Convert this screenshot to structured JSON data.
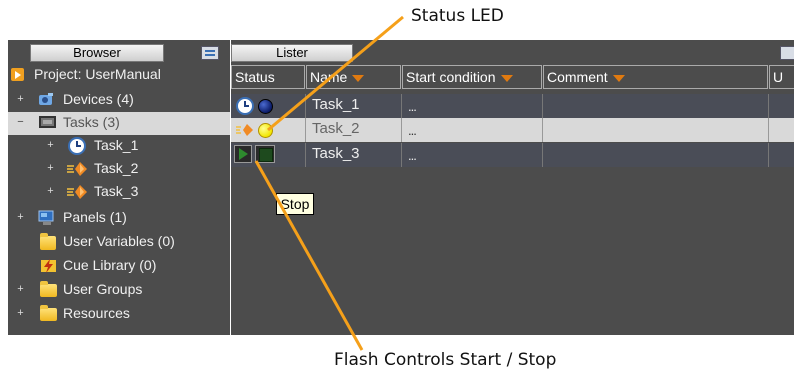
{
  "annotations": {
    "status_led": "Status LED",
    "flash_controls": "Flash Controls Start / Stop"
  },
  "browser": {
    "tab_label": "Browser",
    "items": [
      {
        "label": "Project: UserManual",
        "expander": "",
        "icon": "project-icon"
      },
      {
        "label": "Devices (4)",
        "expander": "+",
        "icon": "devices-icon"
      },
      {
        "label": "Tasks (3)",
        "expander": "−",
        "icon": "tasks-icon",
        "selected": true
      },
      {
        "label": "Task_1",
        "expander": "+",
        "icon": "clock-icon"
      },
      {
        "label": "Task_2",
        "expander": "+",
        "icon": "flash-icon"
      },
      {
        "label": "Task_3",
        "expander": "+",
        "icon": "flash-icon"
      },
      {
        "label": "Panels (1)",
        "expander": "+",
        "icon": "panels-icon"
      },
      {
        "label": "User Variables (0)",
        "expander": "",
        "icon": "variables-icon"
      },
      {
        "label": "Cue Library (0)",
        "expander": "",
        "icon": "cue-icon"
      },
      {
        "label": "User Groups",
        "expander": "+",
        "icon": "folder-icon"
      },
      {
        "label": "Resources",
        "expander": "+",
        "icon": "folder-icon"
      }
    ]
  },
  "lister": {
    "tab_label": "Lister",
    "columns": [
      "Status",
      "Name",
      "Start condition",
      "Comment",
      "U"
    ],
    "rows": [
      {
        "name": "Task_1",
        "start_condition": "...",
        "comment": "",
        "led_color": "#0a1a66"
      },
      {
        "name": "Task_2",
        "start_condition": "...",
        "comment": "",
        "led_color": "#f2e600"
      },
      {
        "name": "Task_3",
        "start_condition": "...",
        "comment": "",
        "led_color": "#1e4a1e"
      }
    ]
  },
  "tooltip": {
    "text": "Stop"
  },
  "colors": {
    "callout_line": "#f5a01a",
    "panel_bg": "#4c4c4c",
    "selected_row": "#d9d9d9"
  }
}
